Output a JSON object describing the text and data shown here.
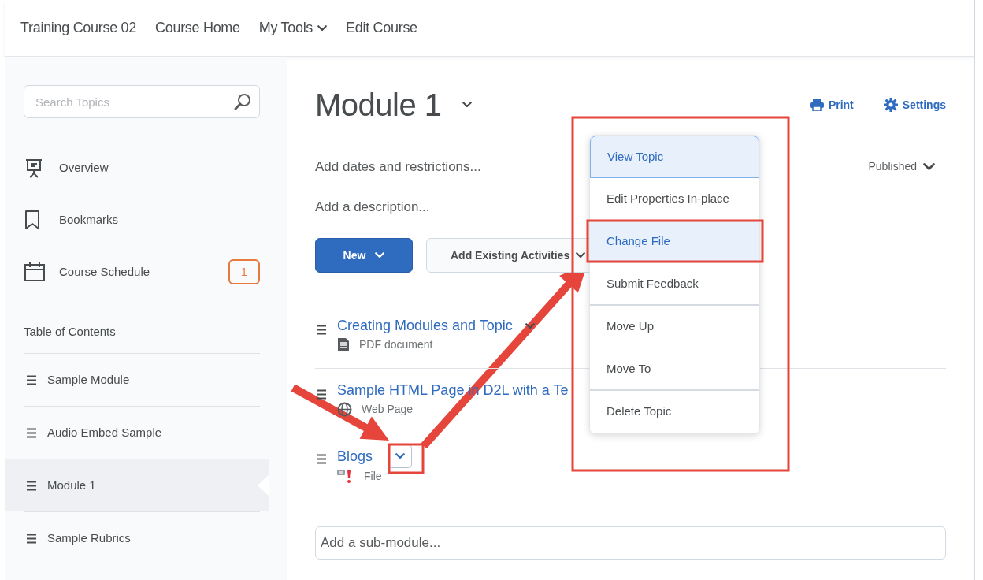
{
  "nav": {
    "links": [
      {
        "label": "Training Course 02",
        "dropdown": false
      },
      {
        "label": "Course Home",
        "dropdown": false
      },
      {
        "label": "My Tools",
        "dropdown": true
      },
      {
        "label": "Edit Course",
        "dropdown": false
      }
    ]
  },
  "sidebar": {
    "search": {
      "placeholder": "Search Topics"
    },
    "items": [
      {
        "label": "Overview",
        "kind": "overview"
      },
      {
        "label": "Bookmarks",
        "kind": "bookmarks"
      },
      {
        "label": "Course Schedule",
        "kind": "schedule",
        "badge": "1"
      }
    ],
    "toc_title": "Table of Contents",
    "modules": [
      {
        "label": "Sample Module",
        "selected": false
      },
      {
        "label": "Audio Embed Sample",
        "selected": false
      },
      {
        "label": "Module 1",
        "selected": true
      },
      {
        "label": "Sample Rubrics",
        "selected": false
      }
    ]
  },
  "module": {
    "title": "Module 1",
    "actions": [
      {
        "label": "Print",
        "kind": "print"
      },
      {
        "label": "Settings",
        "kind": "settings"
      }
    ],
    "dates": "Add dates and restrictions...",
    "description": "Add a description...",
    "status": "Published",
    "buttons": [
      {
        "label": "New",
        "kind": "primary"
      },
      {
        "label": "Add Existing Activities",
        "kind": "secondary"
      }
    ],
    "topics": [
      {
        "title": "Creating Modules and Topic",
        "type": "PDF document",
        "kind": "pdf",
        "chevron": true,
        "menu_open": false
      },
      {
        "title": "Sample HTML Page in D2L with a Te",
        "type": "Web Page",
        "kind": "web",
        "chevron": false
      },
      {
        "title": "Blogs",
        "type": "File",
        "kind": "file",
        "chevron": true,
        "menu_open": true
      }
    ],
    "submodule": {
      "placeholder": "Add a sub-module..."
    }
  },
  "context_menu": {
    "items": [
      {
        "label": "View Topic",
        "highlighted": true,
        "divider_after": false
      },
      {
        "label": "Edit Properties In-place",
        "highlighted": false,
        "divider_after": false
      },
      {
        "label": "Change File",
        "highlighted": true,
        "divider_after": false
      },
      {
        "label": "Submit Feedback",
        "highlighted": false,
        "divider_after": true
      },
      {
        "label": "Move Up",
        "highlighted": false,
        "divider_after": false
      },
      {
        "label": "Move To",
        "highlighted": false,
        "divider_after": true
      },
      {
        "label": "Delete Topic",
        "highlighted": false,
        "divider_after": false
      }
    ]
  }
}
